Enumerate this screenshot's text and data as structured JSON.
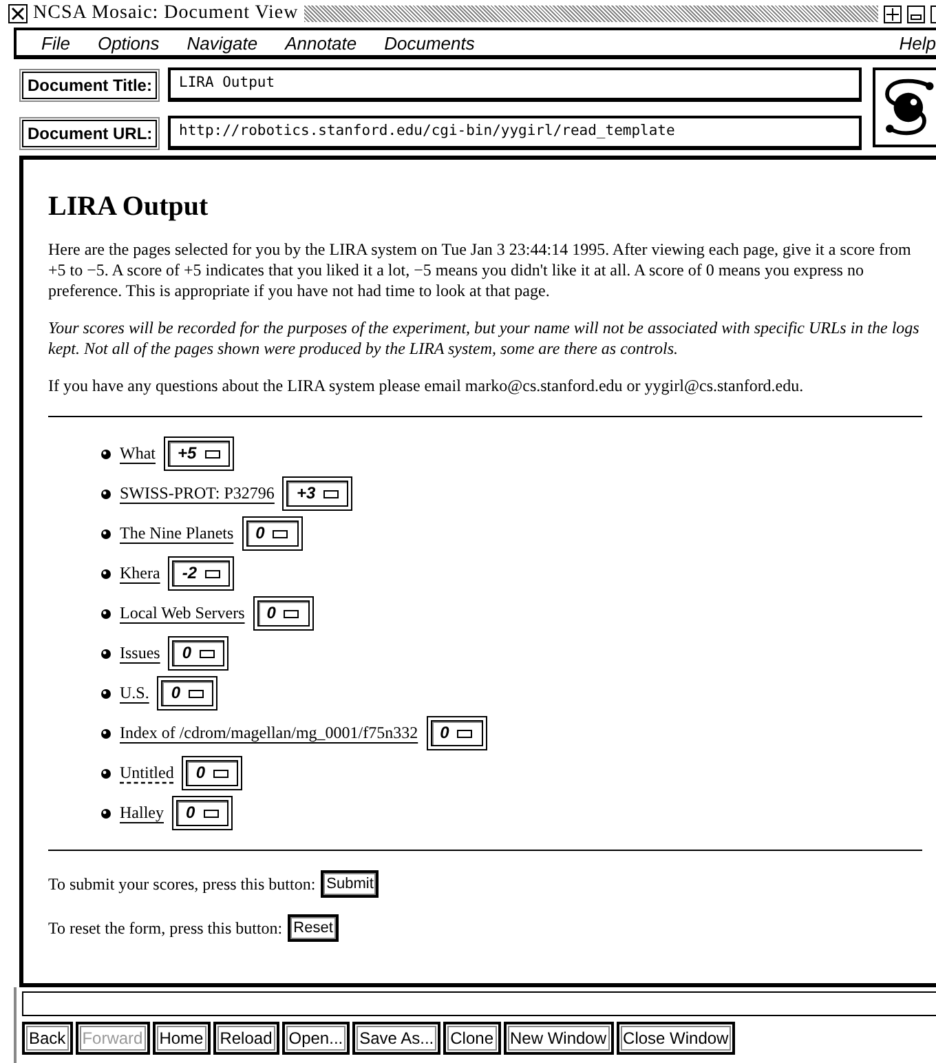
{
  "window": {
    "title": "NCSA Mosaic: Document View"
  },
  "menu": [
    {
      "label": "File"
    },
    {
      "label": "Options"
    },
    {
      "label": "Navigate"
    },
    {
      "label": "Annotate"
    },
    {
      "label": "Documents"
    },
    {
      "label": "Help"
    }
  ],
  "document_title": {
    "label": "Document Title:",
    "value": "LIRA Output"
  },
  "document_url": {
    "label": "Document URL:",
    "value": "http://robotics.stanford.edu/cgi-bin/yygirl/read_template"
  },
  "page": {
    "heading": "LIRA Output",
    "intro": "Here are the pages selected for you by the LIRA system on Tue Jan 3 23:44:14 1995. After viewing each page, give it a score from +5 to −5. A score of +5 indicates that you liked it a lot, −5 means you didn't like it at all. A score of 0 means you express no preference. This is appropriate if you have not had time to look at that page.",
    "notice": "Your scores will be recorded for the purposes of the experiment, but your name will not be associated with specific URLs in the logs kept. Not all of the pages shown were produced by the LIRA system, some are there as controls.",
    "contact": "If you have any questions about the LIRA system please email marko@cs.stanford.edu or yygirl@cs.stanford.edu.",
    "items": [
      {
        "link": "What",
        "visited": false,
        "score": "+5"
      },
      {
        "link": "SWISS-PROT: P32796",
        "visited": false,
        "score": "+3"
      },
      {
        "link": "The Nine Planets",
        "visited": false,
        "score": "0"
      },
      {
        "link": "Khera",
        "visited": false,
        "score": "-2"
      },
      {
        "link": "Local Web Servers",
        "visited": false,
        "score": "0"
      },
      {
        "link": "Issues",
        "visited": false,
        "score": "0"
      },
      {
        "link": "U.S.",
        "visited": false,
        "score": "0"
      },
      {
        "link": "Index of /cdrom/magellan/mg_0001/f75n332",
        "visited": false,
        "score": "0"
      },
      {
        "link": "Untitled",
        "visited": true,
        "score": "0"
      },
      {
        "link": "Halley",
        "visited": false,
        "score": "0"
      }
    ],
    "submit": {
      "text": "To submit your scores, press this button:",
      "button": "Submit"
    },
    "reset": {
      "text": "To reset the form, press this button:",
      "button": "Reset"
    }
  },
  "toolbar": [
    {
      "label": "Back",
      "disabled": false
    },
    {
      "label": "Forward",
      "disabled": true
    },
    {
      "label": "Home",
      "disabled": false
    },
    {
      "label": "Reload",
      "disabled": false
    },
    {
      "label": "Open...",
      "disabled": false
    },
    {
      "label": "Save As...",
      "disabled": false
    },
    {
      "label": "Clone",
      "disabled": false
    },
    {
      "label": "New Window",
      "disabled": false
    },
    {
      "label": "Close Window",
      "disabled": false
    }
  ]
}
